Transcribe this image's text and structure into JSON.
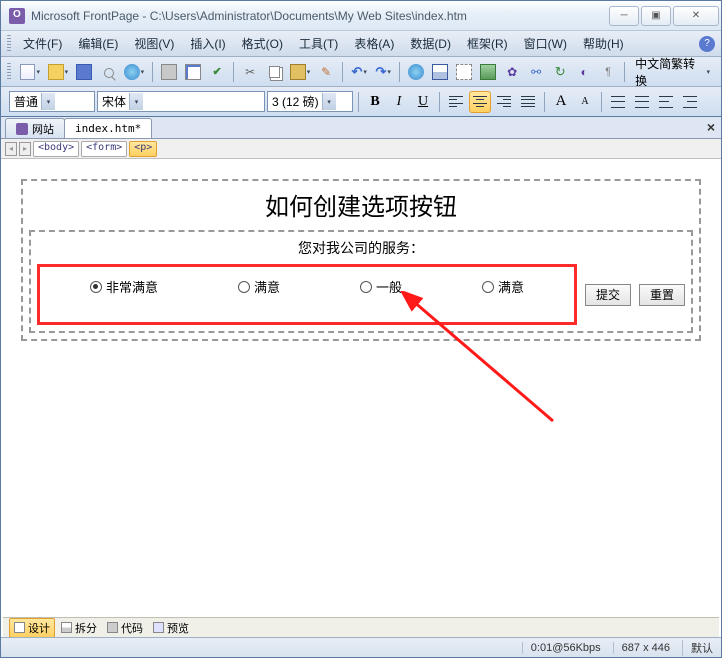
{
  "window": {
    "title": "Microsoft FrontPage - C:\\Users\\Administrator\\Documents\\My Web Sites\\index.htm"
  },
  "menu": {
    "file": "文件(F)",
    "edit": "编辑(E)",
    "view": "视图(V)",
    "insert": "插入(I)",
    "format": "格式(O)",
    "tools": "工具(T)",
    "table": "表格(A)",
    "data": "数据(D)",
    "frame": "框架(R)",
    "window": "窗口(W)",
    "help": "帮助(H)"
  },
  "toolbar": {
    "convert": "中文简繁转换"
  },
  "format": {
    "style": "普通",
    "font": "宋体",
    "size": "3 (12 磅)",
    "bold": "B",
    "italic": "I",
    "underline": "U",
    "grow": "A",
    "shrink": "A"
  },
  "tabs": {
    "site": "网站",
    "file": "index.htm*"
  },
  "tags": {
    "body": "<body>",
    "form": "<form>",
    "p": "<p>"
  },
  "page": {
    "heading": "如何创建选项按钮",
    "question": "您对我公司的服务：",
    "options": [
      "非常满意",
      "满意",
      "一般",
      "满意"
    ],
    "submit": "提交",
    "reset": "重置"
  },
  "views": {
    "design": "设计",
    "split": "拆分",
    "code": "代码",
    "preview": "预览"
  },
  "status": {
    "speed": "0:01@56Kbps",
    "dims": "687 x 446",
    "mode": "默认"
  }
}
